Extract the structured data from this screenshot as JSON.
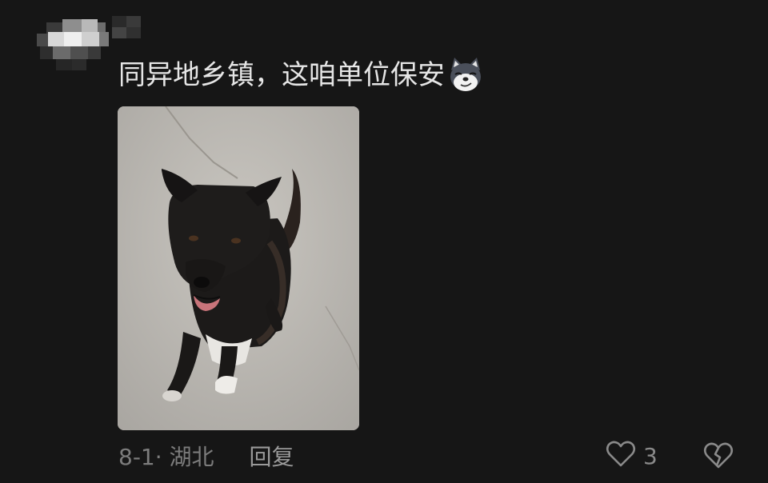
{
  "comment": {
    "text": "同异地乡镇，这咱单位保安",
    "emoji": "dog-face-emoji",
    "image": "black-dog-photo"
  },
  "meta": {
    "date_location": "8-1· 湖北",
    "reply_label": "回复"
  },
  "actions": {
    "like_count": "3",
    "like_icon": "heart-outline-icon",
    "dislike_icon": "broken-heart-icon"
  },
  "colors": {
    "background": "#161616",
    "text": "#e6e6e6",
    "meta": "#7c7c7c"
  }
}
